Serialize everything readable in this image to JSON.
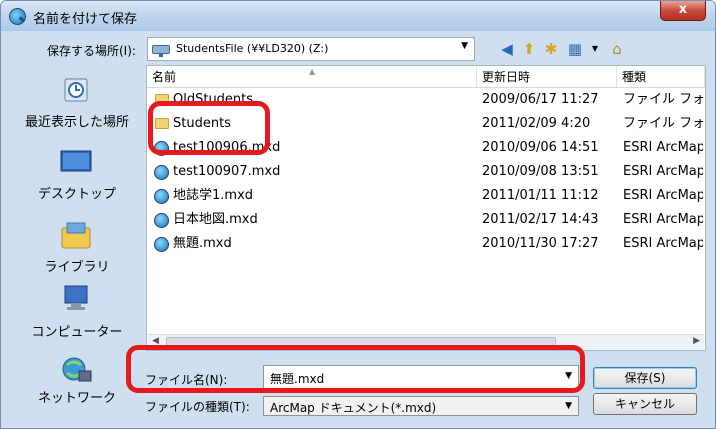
{
  "window": {
    "title": "名前を付けて保存",
    "close_label": "x"
  },
  "location": {
    "label": "保存する場所(I):",
    "value": "StudentsFile (¥¥LD320) (Z:)"
  },
  "toolbar": {
    "icons": [
      "back-icon",
      "up-folder-icon",
      "new-folder-icon",
      "view-menu-icon",
      "arccatalog-icon"
    ]
  },
  "places": [
    {
      "label": "最近表示した場所",
      "icon": "recent-places-icon"
    },
    {
      "label": "デスクトップ",
      "icon": "desktop-icon"
    },
    {
      "label": "ライブラリ",
      "icon": "libraries-icon"
    },
    {
      "label": "コンピューター",
      "icon": "computer-icon"
    },
    {
      "label": "ネットワーク",
      "icon": "network-icon"
    }
  ],
  "columns": [
    "名前",
    "更新日時",
    "種類"
  ],
  "files": [
    {
      "name": "OldStudents",
      "date": "2009/06/17 11:27",
      "type": "ファイル フォルダー",
      "icon": "folder-icon"
    },
    {
      "name": "Students",
      "date": "2011/02/09 4:20",
      "type": "ファイル フォルダー",
      "icon": "folder-icon"
    },
    {
      "name": "test100906.mxd",
      "date": "2010/09/06 14:51",
      "type": "ESRI ArcMap",
      "icon": "mxd-icon"
    },
    {
      "name": "test100907.mxd",
      "date": "2010/09/08 13:51",
      "type": "ESRI ArcMap",
      "icon": "mxd-icon"
    },
    {
      "name": "地誌学1.mxd",
      "date": "2011/01/11 11:12",
      "type": "ESRI ArcMap",
      "icon": "mxd-icon"
    },
    {
      "name": "日本地図.mxd",
      "date": "2011/02/17 14:43",
      "type": "ESRI ArcMap",
      "icon": "mxd-icon"
    },
    {
      "name": "無題.mxd",
      "date": "2010/11/30 17:27",
      "type": "ESRI ArcMap",
      "icon": "mxd-icon"
    }
  ],
  "filename": {
    "label": "ファイル名(N):",
    "value": "無題.mxd"
  },
  "filetype": {
    "label": "ファイルの種類(T):",
    "value": "ArcMap ドキュメント(*.mxd)"
  },
  "buttons": {
    "save": "保存(S)",
    "cancel": "キャンセル"
  },
  "colors": {
    "highlight": "#e8191c",
    "title_bar": "#bcd3ec",
    "dialog_bg": "#cfdff0"
  }
}
